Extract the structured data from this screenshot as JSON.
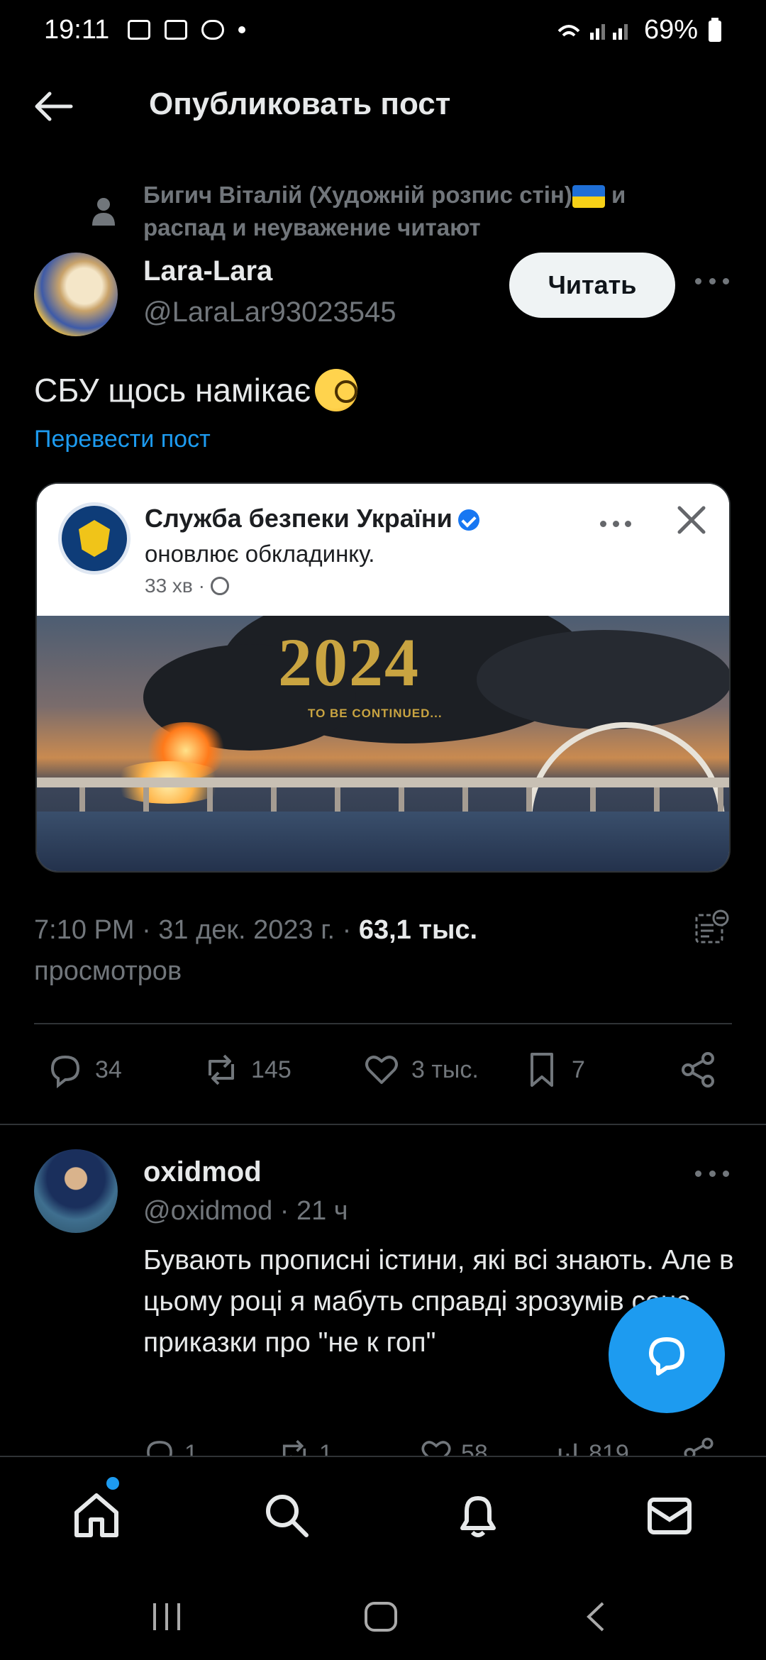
{
  "status_bar": {
    "time": "19:11",
    "battery": "69%"
  },
  "header": {
    "title": "Опубликовать пост"
  },
  "social_context": {
    "text_before_flag": "Бигич Віталій (Художній розпис стін)",
    "text_after_flag": " и распад и неуважение читают"
  },
  "author": {
    "name": "Lara-Lara",
    "handle": "@LaraLar93023545",
    "follow_label": "Читать"
  },
  "post": {
    "text": "СБУ щось намікає",
    "translate_label": "Перевести пост"
  },
  "embedded_card": {
    "org_name": "Служба безпеки України",
    "subtitle": "оновлює обкладинку.",
    "meta": "33 хв ·",
    "image_year": "2024",
    "image_caption": "TO BE CONTINUED..."
  },
  "timestamp": {
    "time_date": "7:10 PM · 31 дек. 2023 г. · ",
    "views_count": "63,1 тыс.",
    "views_label": " просмотров"
  },
  "actions": {
    "replies": "34",
    "reposts": "145",
    "likes": "3 тыс.",
    "bookmarks": "7"
  },
  "reply": {
    "name": "oxidmod",
    "handle": "@oxidmod · 21 ч",
    "text": "Бувають прописні істини, які всі знають. Але в цьому році я мабуть справді зрозумів сенс приказки про \"не к гоп\"",
    "replies": "1",
    "reposts": "1",
    "likes": "58",
    "views": "819"
  },
  "colors": {
    "accent": "#1d9bf0",
    "background": "#000000",
    "muted": "#71767b",
    "text": "#e7e9ea"
  },
  "icons": [
    "back-arrow-icon",
    "person-icon",
    "more-icon",
    "close-icon",
    "globe-icon",
    "verified-icon",
    "analytics-icon",
    "reply-icon",
    "repost-icon",
    "like-icon",
    "bookmark-icon",
    "share-icon",
    "compose-icon",
    "home-icon",
    "search-icon",
    "notifications-icon",
    "messages-icon"
  ]
}
